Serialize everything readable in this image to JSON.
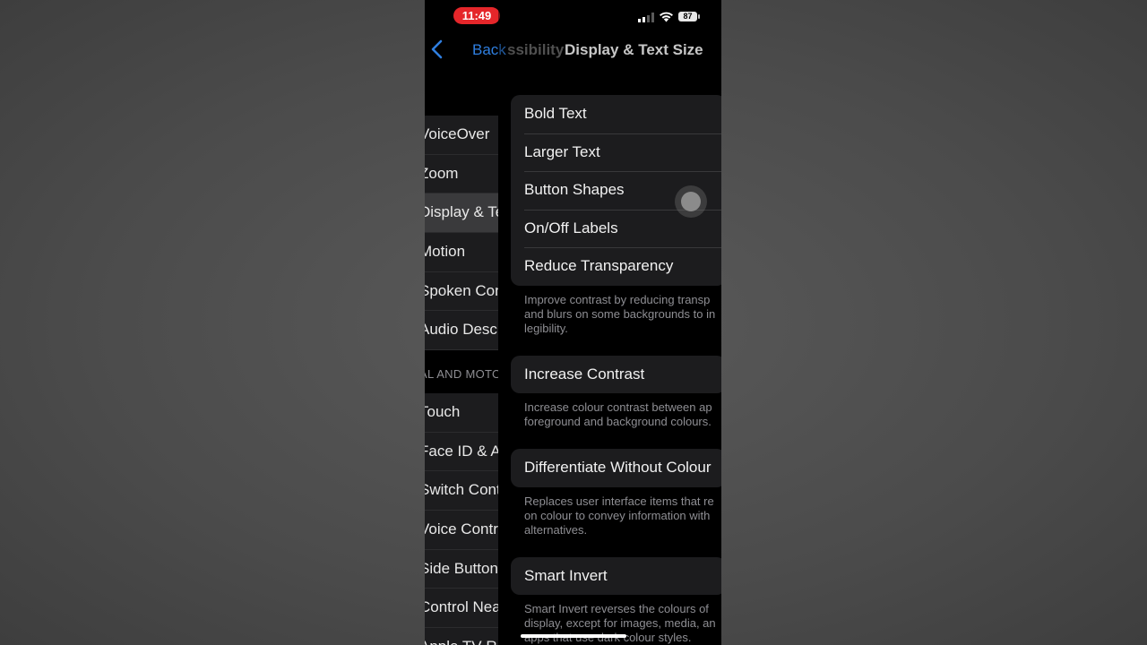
{
  "status_bar": {
    "time": "11:49",
    "battery": "87"
  },
  "nav": {
    "back_label": "Back",
    "previous_title": "ssibility",
    "title": "Display & Text Size"
  },
  "background_list": {
    "group1": [
      "VoiceOver",
      "Zoom",
      "Display & Te",
      "Motion",
      "Spoken Con",
      "Audio Descr"
    ],
    "section_header": "AL AND MOTO",
    "group2": [
      "Touch",
      "Face ID & At",
      "Switch Cont",
      "Voice Contro",
      "Side Button",
      "Control Nea",
      "Apple TV Re"
    ]
  },
  "settings": {
    "group1": [
      "Bold Text",
      "Larger Text",
      "Button Shapes",
      "On/Off Labels",
      "Reduce Transparency"
    ],
    "footer1": [
      "Improve contrast by reducing transp",
      "and blurs on some backgrounds to in",
      "legibility."
    ],
    "group2": [
      "Increase Contrast"
    ],
    "footer2": [
      "Increase colour contrast between ap",
      "foreground and background colours."
    ],
    "group3": [
      "Differentiate Without Colour"
    ],
    "footer3": [
      "Replaces user interface items that re",
      "on colour to convey information with",
      "alternatives."
    ],
    "group4": [
      "Smart Invert"
    ],
    "footer4": [
      "Smart Invert reverses the colours of",
      "display, except for images, media, an",
      "apps that use dark colour styles."
    ]
  },
  "colors": {
    "accent": "#0a84ff",
    "time_pill": "#e5262a"
  }
}
